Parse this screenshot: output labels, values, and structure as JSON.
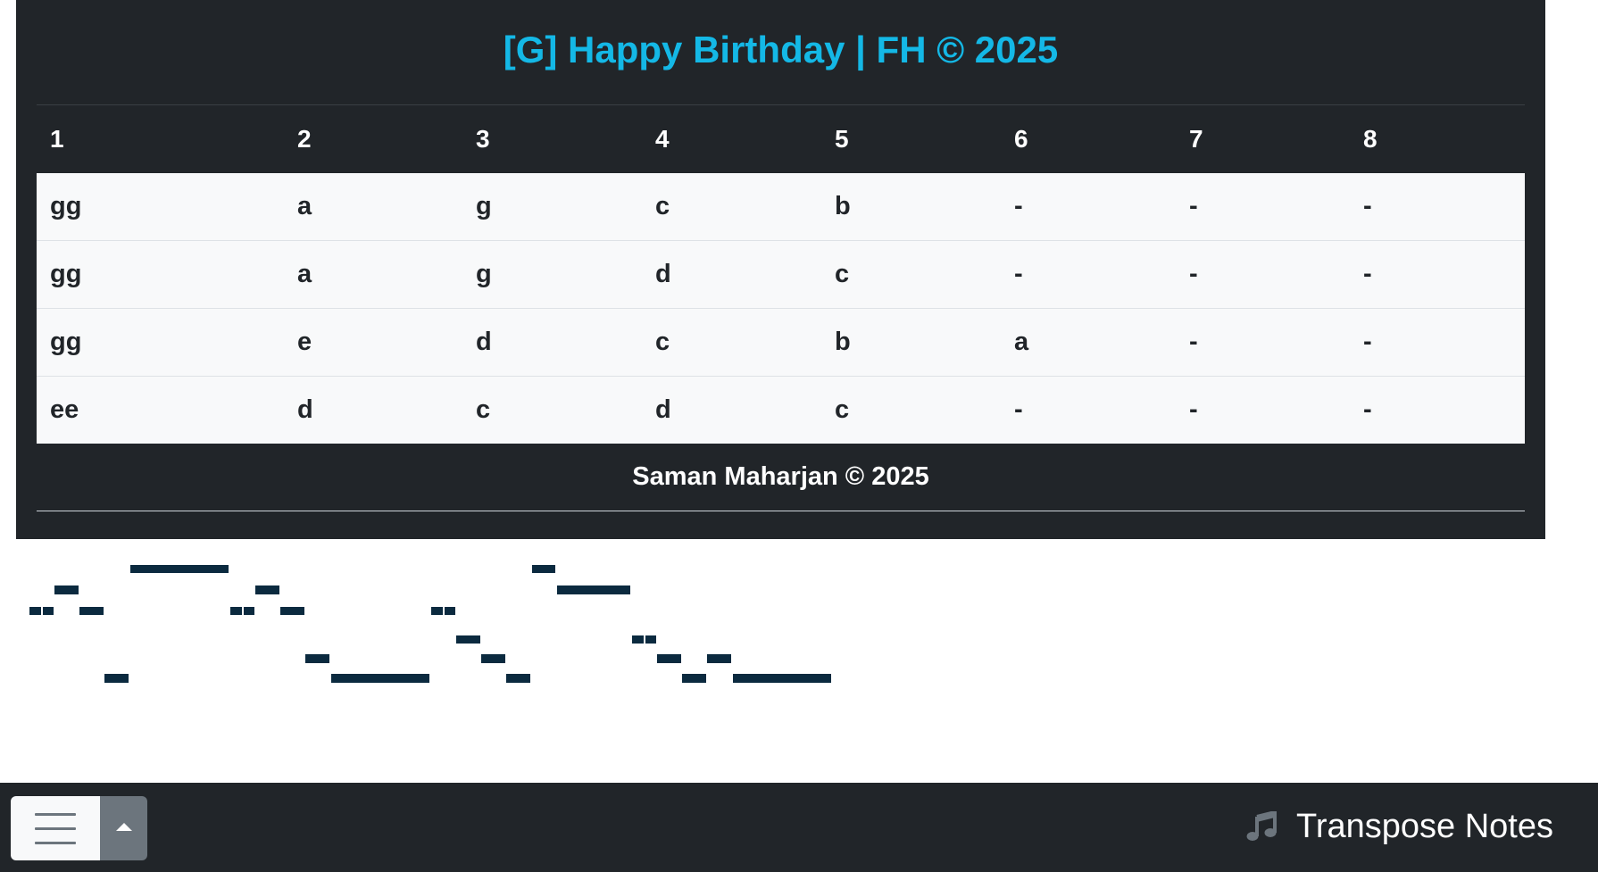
{
  "song": {
    "title": "[G] Happy Birthday | FH © 2025",
    "columns": [
      "1",
      "2",
      "3",
      "4",
      "5",
      "6",
      "7",
      "8"
    ],
    "rows": [
      [
        "gg",
        "a",
        "g",
        "c",
        "b",
        "-",
        "-",
        "-"
      ],
      [
        "gg",
        "a",
        "g",
        "d",
        "c",
        "-",
        "-",
        "-"
      ],
      [
        "gg",
        "e",
        "d",
        "c",
        "b",
        "a",
        "-",
        "-"
      ],
      [
        "ee",
        "d",
        "c",
        "d",
        "c",
        "-",
        "-",
        "-"
      ]
    ],
    "credit": "Saman Maharjan © 2025"
  },
  "colors": {
    "title": "#14b8e6",
    "card_background": "#212529",
    "note_bar": "#0b2a3f"
  },
  "bottom_bar": {
    "menu_icon": "hamburger-icon",
    "scroll_top_icon": "caret-up-icon",
    "brand_icon": "music-note-icon",
    "brand_label": "Transpose Notes"
  }
}
